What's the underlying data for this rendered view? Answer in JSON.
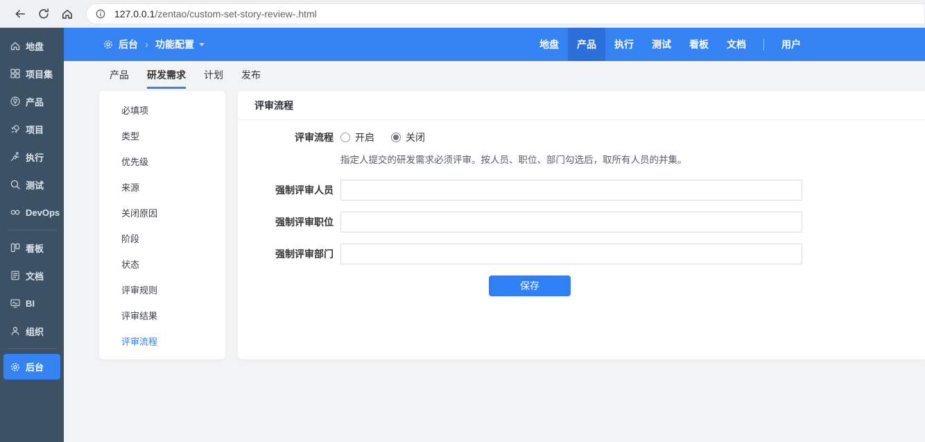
{
  "browser": {
    "url_host": "127.0.0.1",
    "url_path": "/zentao/custom-set-story-review-.html"
  },
  "sidebar": {
    "items": [
      {
        "label": "地盘",
        "icon": "home-icon"
      },
      {
        "label": "项目集",
        "icon": "grid-icon"
      },
      {
        "label": "产品",
        "icon": "bulb-icon"
      },
      {
        "label": "项目",
        "icon": "rocket-icon"
      },
      {
        "label": "执行",
        "icon": "runner-icon"
      },
      {
        "label": "测试",
        "icon": "magnifier-icon"
      },
      {
        "label": "DevOps",
        "icon": "infinity-icon"
      },
      {
        "label": "看板",
        "icon": "kanban-icon"
      },
      {
        "label": "文档",
        "icon": "document-icon"
      },
      {
        "label": "BI",
        "icon": "monitor-icon"
      },
      {
        "label": "组织",
        "icon": "person-icon"
      },
      {
        "label": "后台",
        "icon": "gear-icon",
        "active": true
      }
    ]
  },
  "topbar": {
    "breadcrumb": {
      "root": "后台",
      "current": "功能配置"
    },
    "nav": [
      "地盘",
      "产品",
      "执行",
      "测试",
      "看板",
      "文档",
      "用户"
    ],
    "active_nav": "产品"
  },
  "tabs": {
    "items": [
      "产品",
      "研发需求",
      "计划",
      "发布"
    ],
    "active": "研发需求"
  },
  "menu": {
    "items": [
      "必填项",
      "类型",
      "优先级",
      "来源",
      "关闭原因",
      "阶段",
      "状态",
      "评审规则",
      "评审结果",
      "评审流程"
    ],
    "active": "评审流程"
  },
  "panel": {
    "title": "评审流程",
    "form": {
      "flow_label": "评审流程",
      "radio_on": "开启",
      "radio_off": "关闭",
      "selected_radio": "关闭",
      "help": "指定人提交的研发需求必须评审。按人员、职位、部门勾选后，取所有人员的并集。",
      "fields": [
        {
          "label": "强制评审人员",
          "value": ""
        },
        {
          "label": "强制评审职位",
          "value": ""
        },
        {
          "label": "强制评审部门",
          "value": ""
        }
      ],
      "save_label": "保存"
    }
  },
  "colors": {
    "primary_blue": "#3583f2",
    "active_nav_blue": "#2b6fd9",
    "sidebar_bg": "#3d5165",
    "save_button_blue": "#2f80f5",
    "workspace_bg": "#f2f3f5"
  }
}
